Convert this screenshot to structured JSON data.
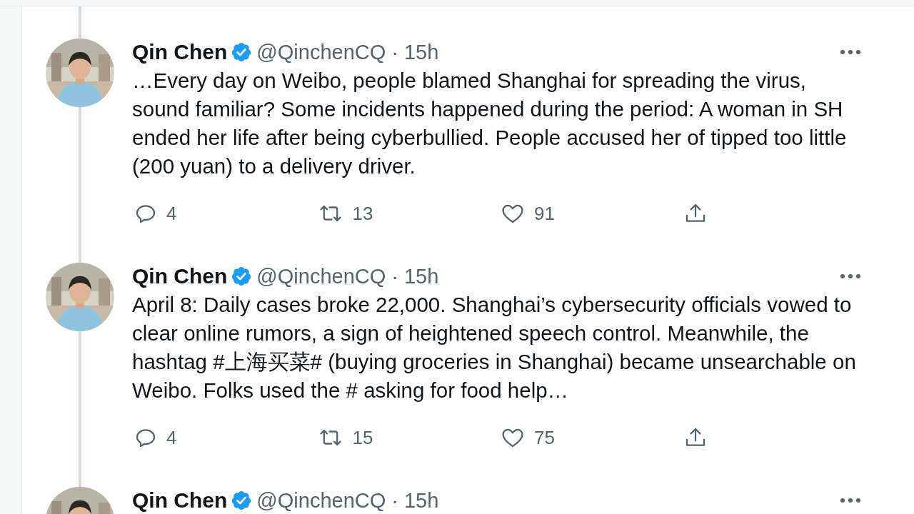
{
  "tweets": [
    {
      "name": "Qin Chen",
      "verified": true,
      "handle": "@QinchenCQ",
      "separator": "·",
      "time": "15h",
      "text": "…Every day on Weibo, people blamed Shanghai for spreading the virus, sound familiar? Some incidents happened during the period: A woman in SH ended her life after being cyberbullied. People accused her of tipped too little (200 yuan) to a delivery driver.",
      "replies": "4",
      "retweets": "13",
      "likes": "91"
    },
    {
      "name": "Qin Chen",
      "verified": true,
      "handle": "@QinchenCQ",
      "separator": "·",
      "time": "15h",
      "text": "April 8: Daily cases broke 22,000. Shanghai’s cybersecurity officials vowed to clear online rumors, a sign of heightened speech control. Meanwhile, the hashtag #上海买菜# (buying groceries in Shanghai) became unsearchable on Weibo. Folks used the # asking for food help…",
      "replies": "4",
      "retweets": "15",
      "likes": "75"
    },
    {
      "name": "Qin Chen",
      "verified": true,
      "handle": "@QinchenCQ",
      "separator": "·",
      "time": "15h"
    }
  ]
}
